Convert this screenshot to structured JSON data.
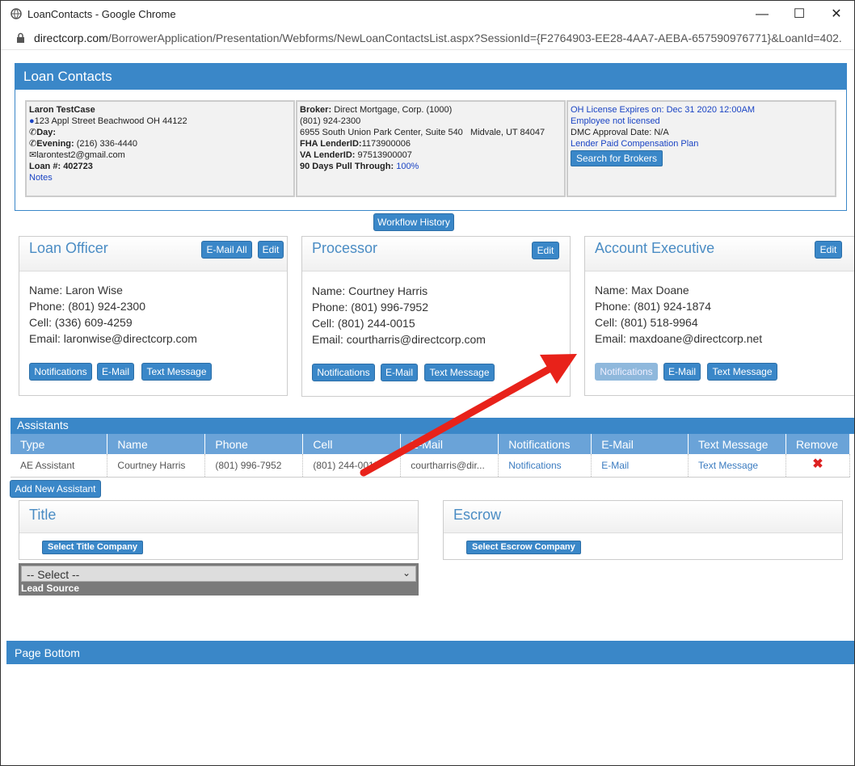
{
  "window": {
    "title": "LoanContacts - Google Chrome",
    "url_host": "directcorp.com",
    "url_path": "/BorrowerApplication/Presentation/Webforms/NewLoanContactsList.aspx?SessionId={F2764903-EE28-4AA7-AEBA-657590976771}&LoanId=402..."
  },
  "header": {
    "title": "Loan Contacts"
  },
  "borrower": {
    "name": "Laron TestCase",
    "address": "123 Appl Street Beachwood OH 44122",
    "day_label": "Day:",
    "evening_label": "Evening:",
    "evening": "(216) 336-4440",
    "email": "larontest2@gmail.com",
    "loan_label": "Loan #:",
    "loan": "402723",
    "notes": "Notes"
  },
  "broker": {
    "label": "Broker:",
    "name": "Direct Mortgage, Corp. (1000)",
    "phone": "(801) 924-2300",
    "address": "6955 South Union Park Center, Suite 540   Midvale, UT 84047",
    "fha_label": "FHA LenderID:",
    "fha": "1173900006",
    "va_label": "VA LenderID:",
    "va": "97513900007",
    "pull_label": "90 Days Pull Through:",
    "pull": "100%"
  },
  "license": {
    "expires": "OH License Expires on: Dec 31 2020 12:00AM",
    "employee": "Employee not licensed",
    "dmc": "DMC Approval Date: N/A",
    "plan": "Lender Paid Compensation Plan",
    "search_btn": "Search for Brokers"
  },
  "workflow_btn": "Workflow History",
  "loan_officer": {
    "title": "Loan Officer",
    "email_all": "E-Mail All",
    "edit": "Edit",
    "name": "Name: Laron Wise",
    "phone": "Phone: (801) 924-2300",
    "cell": "Cell: (336) 609-4259",
    "email": "Email: laronwise@directcorp.com",
    "notifications": "Notifications",
    "email_btn": "E-Mail",
    "text_btn": "Text Message"
  },
  "processor": {
    "title": "Processor",
    "edit": "Edit",
    "name": "Name: Courtney Harris",
    "phone": "Phone: (801) 996-7952",
    "cell": "Cell: (801) 244-0015",
    "email": "Email: courtharris@directcorp.com",
    "notifications": "Notifications",
    "email_btn": "E-Mail",
    "text_btn": "Text Message"
  },
  "account_exec": {
    "title": "Account Executive",
    "edit": "Edit",
    "name": "Name: Max Doane",
    "phone": "Phone: (801) 924-1874",
    "cell": "Cell: (801) 518-9964",
    "email": "Email: maxdoane@directcorp.net",
    "notifications": "Notifications",
    "email_btn": "E-Mail",
    "text_btn": "Text Message"
  },
  "assistants": {
    "title": "Assistants",
    "columns": [
      "Type",
      "Name",
      "Phone",
      "Cell",
      "E-Mail",
      "Notifications",
      "E-Mail",
      "Text Message",
      "Remove"
    ],
    "rows": [
      {
        "type": "AE Assistant",
        "name": "Courtney Harris",
        "phone": "(801) 996-7952",
        "cell": "(801) 244-0015",
        "email": "courtharris@dir...",
        "notifications": "Notifications",
        "email_link": "E-Mail",
        "text": "Text Message"
      }
    ],
    "add_btn": "Add New Assistant"
  },
  "title_sec": {
    "title": "Title",
    "btn": "Select Title Company"
  },
  "escrow_sec": {
    "title": "Escrow",
    "btn": "Select Escrow Company"
  },
  "lead": {
    "select": "-- Select --",
    "label": "Lead Source"
  },
  "page_bottom": "Page Bottom"
}
